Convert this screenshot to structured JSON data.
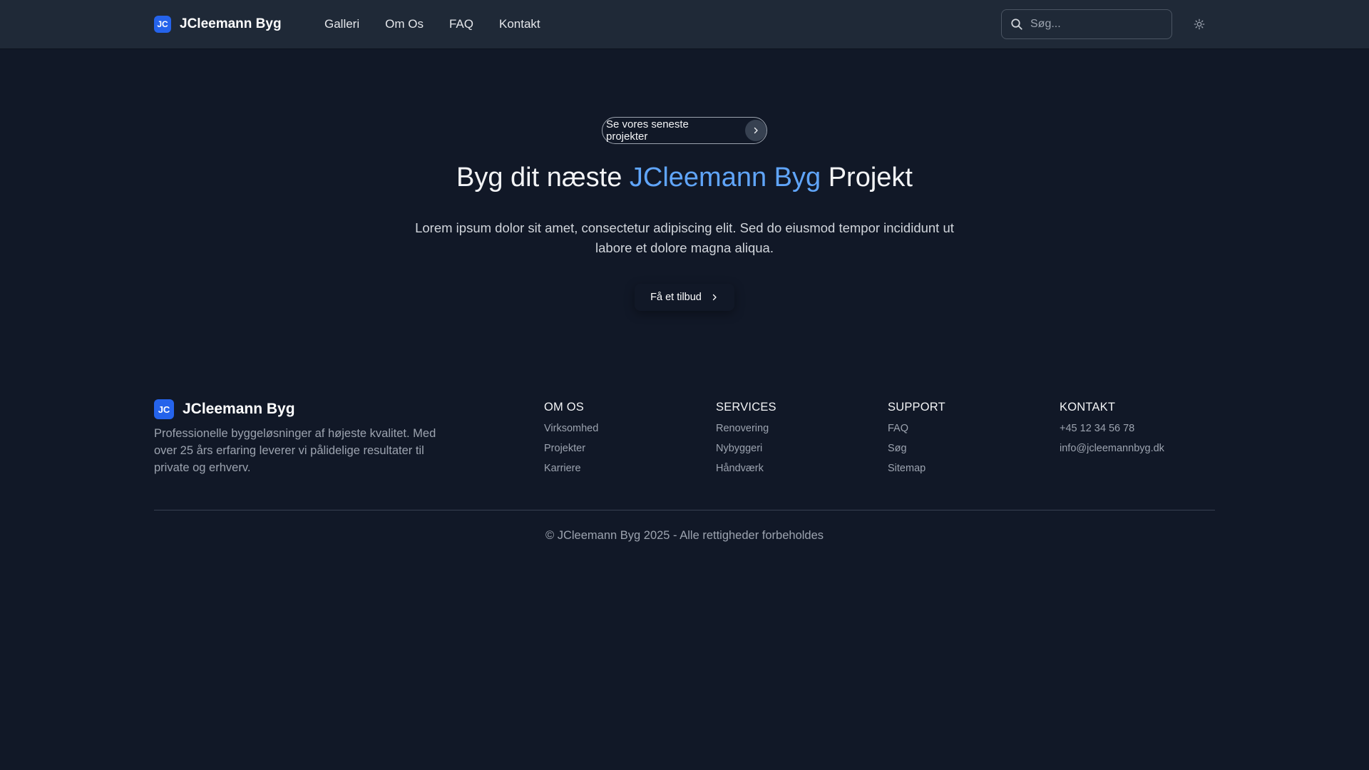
{
  "header": {
    "brand_badge": "JC",
    "brand_name": "JCleemann Byg",
    "nav": [
      {
        "label": "Galleri"
      },
      {
        "label": "Om Os"
      },
      {
        "label": "FAQ"
      },
      {
        "label": "Kontakt"
      }
    ],
    "search_placeholder": "Søg...",
    "search_icon": "search-icon",
    "theme_icon": "sun-icon"
  },
  "hero": {
    "pill_label": "Se vores seneste projekter",
    "title_prefix": "Byg dit næste ",
    "title_accent": "JCleemann Byg",
    "title_suffix": " Projekt",
    "description": "Lorem ipsum dolor sit amet, consectetur adipiscing elit. Sed do eiusmod tempor incididunt ut labore et dolore magna aliqua.",
    "cta_label": "Få et tilbud"
  },
  "footer": {
    "brand_badge": "JC",
    "brand_name": "JCleemann Byg",
    "description": "Professionelle byggeløsninger af højeste kvalitet. Med over 25 års erfaring leverer vi pålidelige resultater til private og erhverv.",
    "columns": [
      {
        "title": "OM OS",
        "links": [
          "Virksomhed",
          "Projekter",
          "Karriere"
        ]
      },
      {
        "title": "SERVICES",
        "links": [
          "Renovering",
          "Nybyggeri",
          "Håndværk"
        ]
      },
      {
        "title": "SUPPORT",
        "links": [
          "FAQ",
          "Søg",
          "Sitemap"
        ]
      },
      {
        "title": "KONTAKT",
        "links": [
          "+45 12 34 56 78",
          "info@jcleemannbyg.dk"
        ]
      }
    ],
    "copyright": "© JCleemann Byg 2025 - Alle rettigheder forbeholdes"
  },
  "colors": {
    "background": "#111827",
    "header_bg": "#1f2937",
    "accent": "#60a5fa",
    "badge": "#2563eb"
  }
}
